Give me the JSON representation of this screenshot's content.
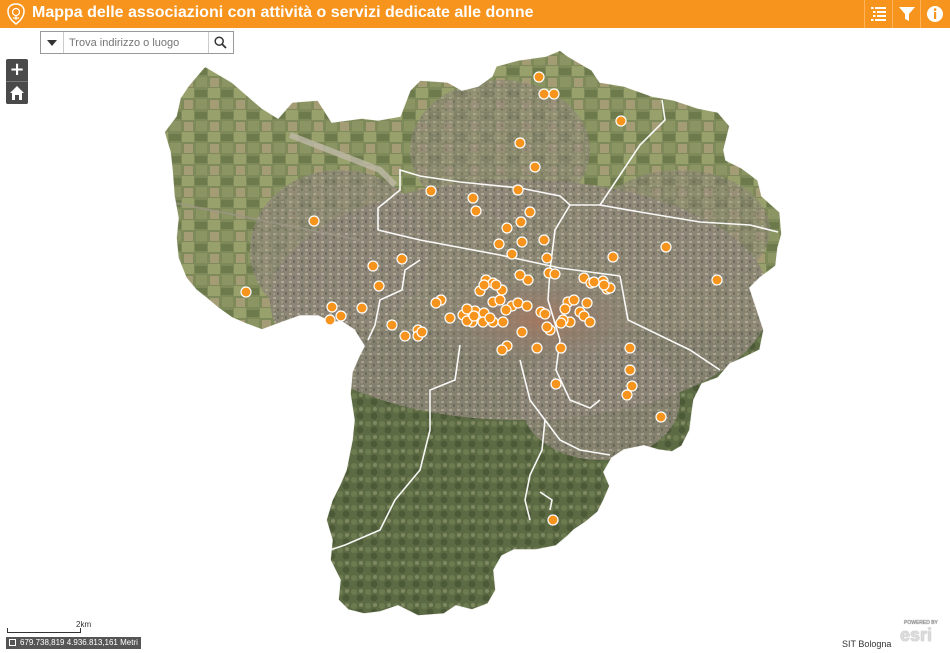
{
  "header": {
    "title": "Mappa delle associazioni con attività o servizi dedicate alle donne",
    "background": "#f7941d",
    "buttons": [
      "list-icon",
      "filter-icon",
      "info-icon"
    ]
  },
  "search": {
    "placeholder": "Trova indirizzo o luogo"
  },
  "zoom": {
    "in_label": "+",
    "out_label": "−"
  },
  "scale": {
    "label": "2km"
  },
  "coordinates": {
    "text": "679.738,819 4.936.813,161 Metri"
  },
  "attribution": {
    "text": "SIT Bologna"
  },
  "esri": {
    "text": "esri",
    "powered": "POWERED BY"
  },
  "marker_color": "#f7941d",
  "marker_count": 100
}
